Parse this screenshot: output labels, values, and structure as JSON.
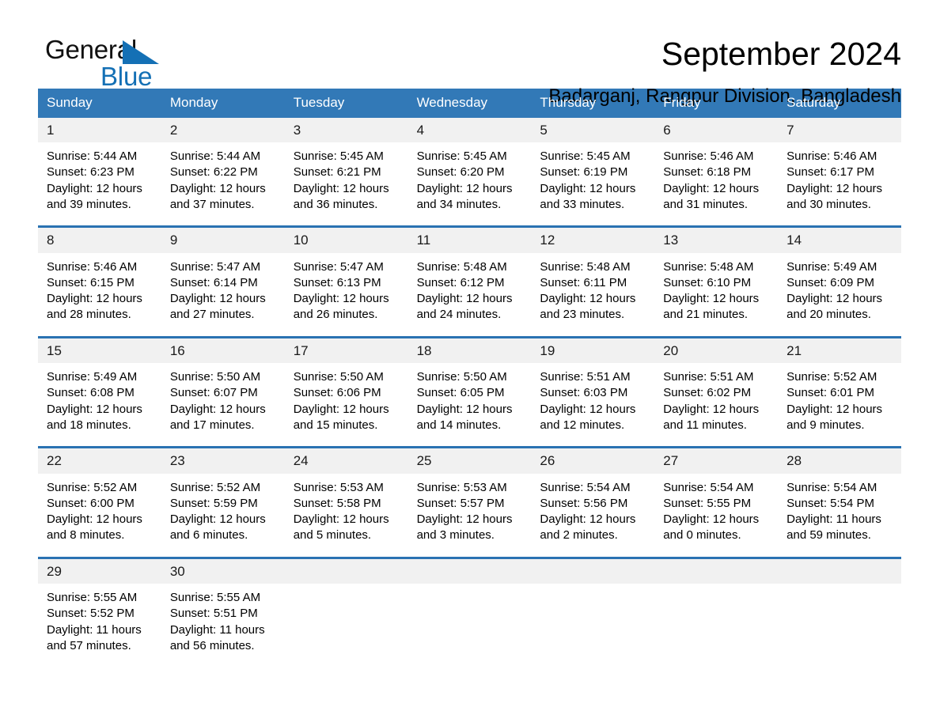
{
  "brand": {
    "name_part1": "General",
    "name_part2": "Blue",
    "accent_color": "#1470b5"
  },
  "header": {
    "title": "September 2024",
    "subtitle": "Badarganj, Rangpur Division, Bangladesh"
  },
  "calendar": {
    "header_bg": "#3279b7",
    "weekday_names": [
      "Sunday",
      "Monday",
      "Tuesday",
      "Wednesday",
      "Thursday",
      "Friday",
      "Saturday"
    ],
    "weeks": [
      [
        {
          "day": "1",
          "sunrise": "Sunrise: 5:44 AM",
          "sunset": "Sunset: 6:23 PM",
          "daylight1": "Daylight: 12 hours",
          "daylight2": "and 39 minutes."
        },
        {
          "day": "2",
          "sunrise": "Sunrise: 5:44 AM",
          "sunset": "Sunset: 6:22 PM",
          "daylight1": "Daylight: 12 hours",
          "daylight2": "and 37 minutes."
        },
        {
          "day": "3",
          "sunrise": "Sunrise: 5:45 AM",
          "sunset": "Sunset: 6:21 PM",
          "daylight1": "Daylight: 12 hours",
          "daylight2": "and 36 minutes."
        },
        {
          "day": "4",
          "sunrise": "Sunrise: 5:45 AM",
          "sunset": "Sunset: 6:20 PM",
          "daylight1": "Daylight: 12 hours",
          "daylight2": "and 34 minutes."
        },
        {
          "day": "5",
          "sunrise": "Sunrise: 5:45 AM",
          "sunset": "Sunset: 6:19 PM",
          "daylight1": "Daylight: 12 hours",
          "daylight2": "and 33 minutes."
        },
        {
          "day": "6",
          "sunrise": "Sunrise: 5:46 AM",
          "sunset": "Sunset: 6:18 PM",
          "daylight1": "Daylight: 12 hours",
          "daylight2": "and 31 minutes."
        },
        {
          "day": "7",
          "sunrise": "Sunrise: 5:46 AM",
          "sunset": "Sunset: 6:17 PM",
          "daylight1": "Daylight: 12 hours",
          "daylight2": "and 30 minutes."
        }
      ],
      [
        {
          "day": "8",
          "sunrise": "Sunrise: 5:46 AM",
          "sunset": "Sunset: 6:15 PM",
          "daylight1": "Daylight: 12 hours",
          "daylight2": "and 28 minutes."
        },
        {
          "day": "9",
          "sunrise": "Sunrise: 5:47 AM",
          "sunset": "Sunset: 6:14 PM",
          "daylight1": "Daylight: 12 hours",
          "daylight2": "and 27 minutes."
        },
        {
          "day": "10",
          "sunrise": "Sunrise: 5:47 AM",
          "sunset": "Sunset: 6:13 PM",
          "daylight1": "Daylight: 12 hours",
          "daylight2": "and 26 minutes."
        },
        {
          "day": "11",
          "sunrise": "Sunrise: 5:48 AM",
          "sunset": "Sunset: 6:12 PM",
          "daylight1": "Daylight: 12 hours",
          "daylight2": "and 24 minutes."
        },
        {
          "day": "12",
          "sunrise": "Sunrise: 5:48 AM",
          "sunset": "Sunset: 6:11 PM",
          "daylight1": "Daylight: 12 hours",
          "daylight2": "and 23 minutes."
        },
        {
          "day": "13",
          "sunrise": "Sunrise: 5:48 AM",
          "sunset": "Sunset: 6:10 PM",
          "daylight1": "Daylight: 12 hours",
          "daylight2": "and 21 minutes."
        },
        {
          "day": "14",
          "sunrise": "Sunrise: 5:49 AM",
          "sunset": "Sunset: 6:09 PM",
          "daylight1": "Daylight: 12 hours",
          "daylight2": "and 20 minutes."
        }
      ],
      [
        {
          "day": "15",
          "sunrise": "Sunrise: 5:49 AM",
          "sunset": "Sunset: 6:08 PM",
          "daylight1": "Daylight: 12 hours",
          "daylight2": "and 18 minutes."
        },
        {
          "day": "16",
          "sunrise": "Sunrise: 5:50 AM",
          "sunset": "Sunset: 6:07 PM",
          "daylight1": "Daylight: 12 hours",
          "daylight2": "and 17 minutes."
        },
        {
          "day": "17",
          "sunrise": "Sunrise: 5:50 AM",
          "sunset": "Sunset: 6:06 PM",
          "daylight1": "Daylight: 12 hours",
          "daylight2": "and 15 minutes."
        },
        {
          "day": "18",
          "sunrise": "Sunrise: 5:50 AM",
          "sunset": "Sunset: 6:05 PM",
          "daylight1": "Daylight: 12 hours",
          "daylight2": "and 14 minutes."
        },
        {
          "day": "19",
          "sunrise": "Sunrise: 5:51 AM",
          "sunset": "Sunset: 6:03 PM",
          "daylight1": "Daylight: 12 hours",
          "daylight2": "and 12 minutes."
        },
        {
          "day": "20",
          "sunrise": "Sunrise: 5:51 AM",
          "sunset": "Sunset: 6:02 PM",
          "daylight1": "Daylight: 12 hours",
          "daylight2": "and 11 minutes."
        },
        {
          "day": "21",
          "sunrise": "Sunrise: 5:52 AM",
          "sunset": "Sunset: 6:01 PM",
          "daylight1": "Daylight: 12 hours",
          "daylight2": "and 9 minutes."
        }
      ],
      [
        {
          "day": "22",
          "sunrise": "Sunrise: 5:52 AM",
          "sunset": "Sunset: 6:00 PM",
          "daylight1": "Daylight: 12 hours",
          "daylight2": "and 8 minutes."
        },
        {
          "day": "23",
          "sunrise": "Sunrise: 5:52 AM",
          "sunset": "Sunset: 5:59 PM",
          "daylight1": "Daylight: 12 hours",
          "daylight2": "and 6 minutes."
        },
        {
          "day": "24",
          "sunrise": "Sunrise: 5:53 AM",
          "sunset": "Sunset: 5:58 PM",
          "daylight1": "Daylight: 12 hours",
          "daylight2": "and 5 minutes."
        },
        {
          "day": "25",
          "sunrise": "Sunrise: 5:53 AM",
          "sunset": "Sunset: 5:57 PM",
          "daylight1": "Daylight: 12 hours",
          "daylight2": "and 3 minutes."
        },
        {
          "day": "26",
          "sunrise": "Sunrise: 5:54 AM",
          "sunset": "Sunset: 5:56 PM",
          "daylight1": "Daylight: 12 hours",
          "daylight2": "and 2 minutes."
        },
        {
          "day": "27",
          "sunrise": "Sunrise: 5:54 AM",
          "sunset": "Sunset: 5:55 PM",
          "daylight1": "Daylight: 12 hours",
          "daylight2": "and 0 minutes."
        },
        {
          "day": "28",
          "sunrise": "Sunrise: 5:54 AM",
          "sunset": "Sunset: 5:54 PM",
          "daylight1": "Daylight: 11 hours",
          "daylight2": "and 59 minutes."
        }
      ],
      [
        {
          "day": "29",
          "sunrise": "Sunrise: 5:55 AM",
          "sunset": "Sunset: 5:52 PM",
          "daylight1": "Daylight: 11 hours",
          "daylight2": "and 57 minutes."
        },
        {
          "day": "30",
          "sunrise": "Sunrise: 5:55 AM",
          "sunset": "Sunset: 5:51 PM",
          "daylight1": "Daylight: 11 hours",
          "daylight2": "and 56 minutes."
        },
        {
          "day": "",
          "sunrise": "",
          "sunset": "",
          "daylight1": "",
          "daylight2": ""
        },
        {
          "day": "",
          "sunrise": "",
          "sunset": "",
          "daylight1": "",
          "daylight2": ""
        },
        {
          "day": "",
          "sunrise": "",
          "sunset": "",
          "daylight1": "",
          "daylight2": ""
        },
        {
          "day": "",
          "sunrise": "",
          "sunset": "",
          "daylight1": "",
          "daylight2": ""
        },
        {
          "day": "",
          "sunrise": "",
          "sunset": "",
          "daylight1": "",
          "daylight2": ""
        }
      ]
    ]
  }
}
